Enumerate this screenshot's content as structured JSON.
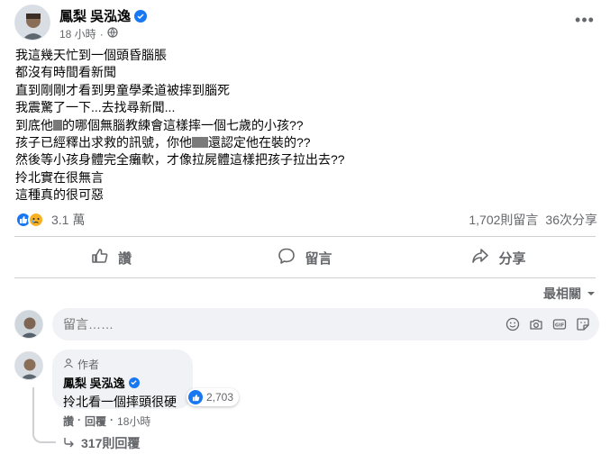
{
  "post": {
    "author": "鳳梨 吳泓逸",
    "time": "18 小時",
    "lines": [
      "我這幾天忙到一個頭昏腦脹",
      "都沒有時間看新聞",
      "直到剛剛才看到男童學柔道被摔到腦死",
      "我震驚了一下...去找尋新聞...",
      [
        "到底他",
        "的哪個無腦教練會這樣摔一個七歲的小孩??"
      ],
      [
        "孩子已經釋出求救的訊號，你他",
        "還認定他在裝的??"
      ],
      "然後等小孩身體完全癱軟，才像拉屍體這樣把孩子拉出去??",
      "拎北實在很無言",
      "這種真的很可惡"
    ]
  },
  "reactions": {
    "count": "3.1 萬",
    "comments": "1,702則留言",
    "shares": "36次分享"
  },
  "actions": {
    "like": "讚",
    "comment": "留言",
    "share": "分享"
  },
  "sort": {
    "label": "最相關"
  },
  "composer": {
    "placeholder": "留言……"
  },
  "top_comment": {
    "badge": "作者",
    "author": "鳳梨 吳泓逸",
    "text": "拎北看一個摔頭很硬",
    "reaction_count": "2,703",
    "like": "讚",
    "reply": "回覆",
    "time": "18小時",
    "replies": "317則回覆"
  },
  "colors": {
    "accent": "#1877f2",
    "muted": "#65676b",
    "bubble": "#f0f2f5"
  }
}
